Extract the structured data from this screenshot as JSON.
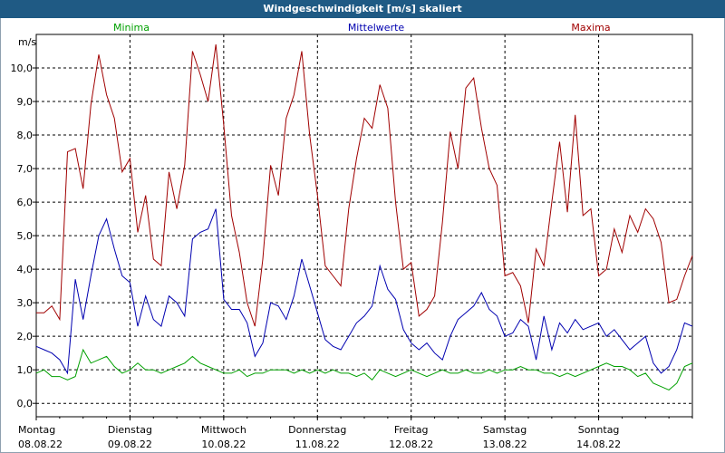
{
  "chart_data": {
    "type": "line",
    "title": "Windgeschwindigkeit [m/s] skaliert",
    "ylabel": "m/s",
    "ylim": [
      -0.4,
      11.0
    ],
    "yticks": [
      "0,0",
      "1,0",
      "2,0",
      "3,0",
      "4,0",
      "5,0",
      "6,0",
      "7,0",
      "8,0",
      "9,0",
      "10,0"
    ],
    "xlim": [
      0,
      168
    ],
    "xticks": [
      {
        "day": "Montag",
        "date": "08.08.22",
        "hour": 0
      },
      {
        "day": "Dienstag",
        "date": "09.08.22",
        "hour": 24
      },
      {
        "day": "Mittwoch",
        "date": "10.08.22",
        "hour": 48
      },
      {
        "day": "Donnerstag",
        "date": "11.08.22",
        "hour": 72
      },
      {
        "day": "Freitag",
        "date": "12.08.22",
        "hour": 96
      },
      {
        "day": "Samstag",
        "date": "13.08.22",
        "hour": 120
      },
      {
        "day": "Sonntag",
        "date": "14.08.22",
        "hour": 144
      }
    ],
    "grid": true,
    "legend_position": "top",
    "series": [
      {
        "name": "Minima",
        "color": "#00a000",
        "x": [
          0,
          2,
          4,
          6,
          8,
          10,
          12,
          14,
          16,
          18,
          20,
          22,
          24,
          26,
          28,
          30,
          32,
          34,
          36,
          38,
          40,
          42,
          44,
          46,
          48,
          50,
          52,
          54,
          56,
          58,
          60,
          62,
          64,
          66,
          68,
          70,
          72,
          74,
          76,
          78,
          80,
          82,
          84,
          86,
          88,
          90,
          92,
          94,
          96,
          98,
          100,
          102,
          104,
          106,
          108,
          110,
          112,
          114,
          116,
          118,
          120,
          122,
          124,
          126,
          128,
          130,
          132,
          134,
          136,
          138,
          140,
          142,
          144,
          146,
          148,
          150,
          152,
          154,
          156,
          158,
          160,
          162,
          164,
          166,
          168
        ],
        "values": [
          0.9,
          1.0,
          0.8,
          0.8,
          0.7,
          0.8,
          1.6,
          1.2,
          1.3,
          1.4,
          1.1,
          0.9,
          1.0,
          1.2,
          1.0,
          1.0,
          0.9,
          1.0,
          1.1,
          1.2,
          1.4,
          1.2,
          1.1,
          1.0,
          0.9,
          0.9,
          1.0,
          0.8,
          0.9,
          0.9,
          1.0,
          1.0,
          1.0,
          0.9,
          1.0,
          0.9,
          1.0,
          0.9,
          1.0,
          0.9,
          0.9,
          0.8,
          0.9,
          0.7,
          1.0,
          0.9,
          0.8,
          0.9,
          1.0,
          0.9,
          0.8,
          0.9,
          1.0,
          0.9,
          0.9,
          1.0,
          0.9,
          0.9,
          1.0,
          0.9,
          1.0,
          1.0,
          1.1,
          1.0,
          1.0,
          0.9,
          0.9,
          0.8,
          0.9,
          0.8,
          0.9,
          1.0,
          1.1,
          1.2,
          1.1,
          1.1,
          1.0,
          0.8,
          0.9,
          0.6,
          0.5,
          0.4,
          0.6,
          1.1,
          1.2
        ]
      },
      {
        "name": "Mittelwerte",
        "color": "#0000b0",
        "x": [
          0,
          2,
          4,
          6,
          8,
          10,
          12,
          14,
          16,
          18,
          20,
          22,
          24,
          26,
          28,
          30,
          32,
          34,
          36,
          38,
          40,
          42,
          44,
          46,
          48,
          50,
          52,
          54,
          56,
          58,
          60,
          62,
          64,
          66,
          68,
          70,
          72,
          74,
          76,
          78,
          80,
          82,
          84,
          86,
          88,
          90,
          92,
          94,
          96,
          98,
          100,
          102,
          104,
          106,
          108,
          110,
          112,
          114,
          116,
          118,
          120,
          122,
          124,
          126,
          128,
          130,
          132,
          134,
          136,
          138,
          140,
          142,
          144,
          146,
          148,
          150,
          152,
          154,
          156,
          158,
          160,
          162,
          164,
          166,
          168
        ],
        "values": [
          1.7,
          1.6,
          1.5,
          1.3,
          0.9,
          3.7,
          2.5,
          3.8,
          5.0,
          5.5,
          4.6,
          3.8,
          3.6,
          2.3,
          3.2,
          2.5,
          2.3,
          3.2,
          3.0,
          2.6,
          4.9,
          5.1,
          5.2,
          5.8,
          3.1,
          2.8,
          2.8,
          2.4,
          1.4,
          1.8,
          3.0,
          2.9,
          2.5,
          3.2,
          4.3,
          3.5,
          2.7,
          1.9,
          1.7,
          1.6,
          2.0,
          2.4,
          2.6,
          2.9,
          4.1,
          3.4,
          3.1,
          2.2,
          1.8,
          1.6,
          1.8,
          1.5,
          1.3,
          2.0,
          2.5,
          2.7,
          2.9,
          3.3,
          2.8,
          2.6,
          2.0,
          2.1,
          2.5,
          2.3,
          1.3,
          2.6,
          1.6,
          2.4,
          2.1,
          2.5,
          2.2,
          2.3,
          2.4,
          2.0,
          2.2,
          1.9,
          1.6,
          1.8,
          2.0,
          1.2,
          0.9,
          1.1,
          1.6,
          2.4,
          2.3
        ]
      },
      {
        "name": "Maxima",
        "color": "#a00000",
        "x": [
          0,
          2,
          4,
          6,
          8,
          10,
          12,
          14,
          16,
          18,
          20,
          22,
          24,
          26,
          28,
          30,
          32,
          34,
          36,
          38,
          40,
          42,
          44,
          46,
          48,
          50,
          52,
          54,
          56,
          58,
          60,
          62,
          64,
          66,
          68,
          70,
          72,
          74,
          76,
          78,
          80,
          82,
          84,
          86,
          88,
          90,
          92,
          94,
          96,
          98,
          100,
          102,
          104,
          106,
          108,
          110,
          112,
          114,
          116,
          118,
          120,
          122,
          124,
          126,
          128,
          130,
          132,
          134,
          136,
          138,
          140,
          142,
          144,
          146,
          148,
          150,
          152,
          154,
          156,
          158,
          160,
          162,
          164,
          166,
          168
        ],
        "values": [
          2.7,
          2.7,
          2.9,
          2.5,
          7.5,
          7.6,
          6.4,
          8.9,
          10.4,
          9.2,
          8.5,
          6.9,
          7.3,
          5.1,
          6.2,
          4.3,
          4.1,
          6.9,
          5.8,
          7.1,
          10.5,
          9.8,
          9.0,
          10.7,
          8.3,
          5.6,
          4.5,
          3.0,
          2.3,
          4.3,
          7.1,
          6.2,
          8.5,
          9.2,
          10.5,
          8.0,
          6.2,
          4.1,
          3.8,
          3.5,
          5.8,
          7.3,
          8.5,
          8.2,
          9.5,
          8.8,
          6.0,
          4.0,
          4.2,
          2.6,
          2.8,
          3.2,
          5.4,
          8.1,
          7.0,
          9.4,
          9.7,
          8.2,
          7.0,
          6.5,
          3.8,
          3.9,
          3.5,
          2.4,
          4.6,
          4.1,
          6.0,
          7.8,
          5.7,
          8.6,
          5.6,
          5.8,
          3.8,
          4.0,
          5.2,
          4.5,
          5.6,
          5.1,
          5.8,
          5.5,
          4.8,
          3.0,
          3.1,
          3.8,
          4.4
        ]
      }
    ]
  }
}
